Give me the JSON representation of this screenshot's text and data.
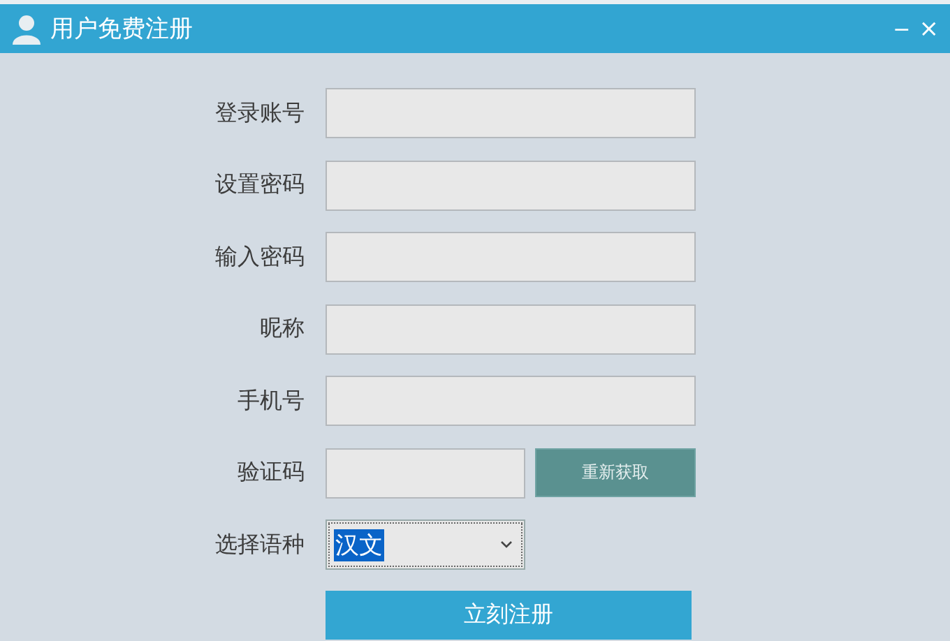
{
  "window": {
    "title": "用户免费注册",
    "controls": [
      {
        "kind": "minimize",
        "glyph": "−"
      },
      {
        "kind": "close",
        "glyph": "×"
      }
    ]
  },
  "form": {
    "rows": [
      {
        "kind": "text",
        "label": "登录账号"
      },
      {
        "kind": "text",
        "label": "设置密码"
      },
      {
        "kind": "text",
        "label": "输入密码"
      },
      {
        "kind": "text",
        "label": "昵称"
      },
      {
        "kind": "text",
        "label": "手机号"
      },
      {
        "kind": "code",
        "label": "验证码",
        "button": "重新获取"
      },
      {
        "kind": "select",
        "label": "选择语种",
        "value": "汉文"
      }
    ],
    "submit": "立刻注册"
  }
}
